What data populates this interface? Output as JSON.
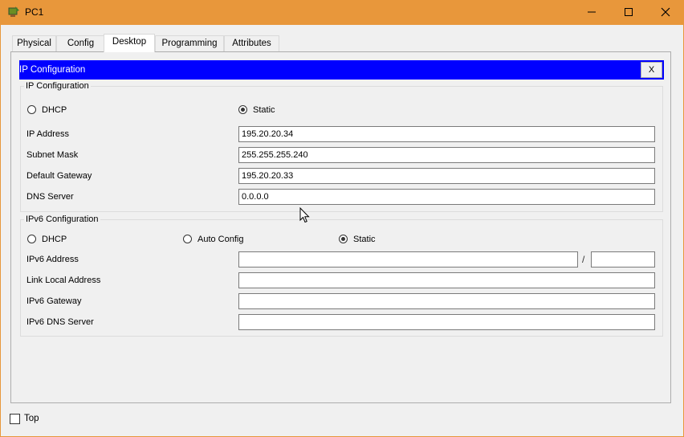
{
  "window": {
    "title": "PC1",
    "minimize_icon": "minimize-icon",
    "maximize_icon": "maximize-icon",
    "close_icon": "close-icon",
    "frame_color": "#e8973b"
  },
  "tabs": [
    {
      "label": "Physical",
      "active": false
    },
    {
      "label": "Config",
      "active": false
    },
    {
      "label": "Desktop",
      "active": true
    },
    {
      "label": "Programming",
      "active": false
    },
    {
      "label": "Attributes",
      "active": false
    }
  ],
  "ip_config": {
    "header_title": "IP Configuration",
    "header_color": "#0000ff",
    "close_label": "X",
    "ipv4": {
      "group_label": "IP Configuration",
      "dhcp_label": "DHCP",
      "static_label": "Static",
      "selected_mode": "Static",
      "ip_address_label": "IP Address",
      "ip_address": "195.20.20.34",
      "subnet_mask_label": "Subnet Mask",
      "subnet_mask": "255.255.255.240",
      "default_gateway_label": "Default Gateway",
      "default_gateway": "195.20.20.33",
      "dns_server_label": "DNS Server",
      "dns_server": "0.0.0.0"
    },
    "ipv6": {
      "group_label": "IPv6 Configuration",
      "dhcp_label": "DHCP",
      "auto_config_label": "Auto Config",
      "static_label": "Static",
      "selected_mode": "Static",
      "ipv6_address_label": "IPv6 Address",
      "ipv6_address": "",
      "prefix_separator": "/",
      "prefix_length": "",
      "link_local_label": "Link Local Address",
      "link_local_address": "",
      "ipv6_gateway_label": "IPv6 Gateway",
      "ipv6_gateway": "",
      "ipv6_dns_label": "IPv6 DNS Server",
      "ipv6_dns_server": ""
    }
  },
  "footer": {
    "top_label": "Top",
    "top_checked": false
  }
}
